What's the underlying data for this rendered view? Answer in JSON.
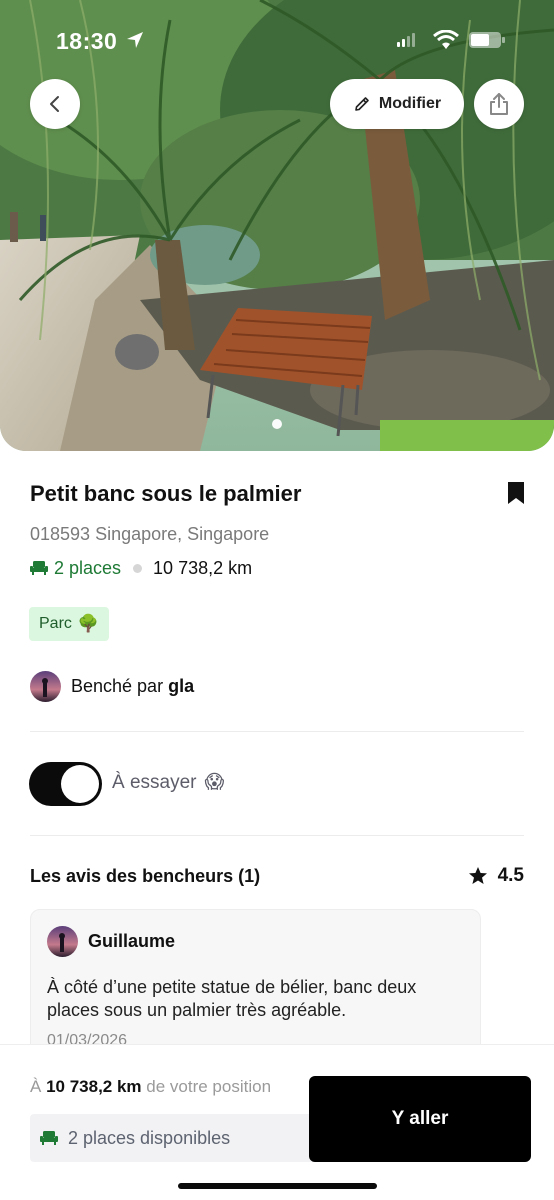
{
  "status_bar": {
    "time": "18:30"
  },
  "header": {
    "edit_label": "Modifier"
  },
  "bench": {
    "title": "Petit banc sous le palmier",
    "address": "018593 Singapore, Singapore",
    "places": "2 places",
    "distance": "10 738,2 km",
    "tag": {
      "label": "Parc",
      "emoji": "🌳"
    },
    "author_prefix": "Benché par",
    "author_name": "gla"
  },
  "toggle": {
    "label": "À essayer",
    "emoji": "😱",
    "on": true
  },
  "reviews": {
    "title": "Les avis des bencheurs (1)",
    "rating": "4.5",
    "items": [
      {
        "name": "Guillaume",
        "text": "À côté d’une petite statue de bélier, banc deux places sous un palmier très agréable.",
        "date": "01/03/2026"
      }
    ]
  },
  "bottom": {
    "prefix": "À",
    "distance": "10 738,2 km",
    "suffix": "de votre position",
    "places_available": "2 places disponibles",
    "go_label": "Y aller"
  },
  "colors": {
    "accent_green": "#1e7a35",
    "tag_bg": "#dcf7df",
    "primary_button": "#000000"
  },
  "icons": [
    "location-arrow-icon",
    "signal-icon",
    "wifi-icon",
    "battery-icon",
    "back-icon",
    "pencil-icon",
    "share-icon",
    "bookmark-icon",
    "bench-icon",
    "star-icon"
  ]
}
